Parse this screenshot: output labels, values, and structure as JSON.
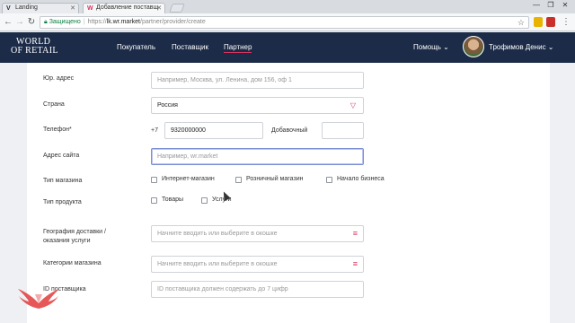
{
  "browser": {
    "tabs": [
      {
        "favicon": "V",
        "title": "Landing"
      },
      {
        "favicon": "W",
        "title": "Добавление поставщ"
      }
    ],
    "window_controls": [
      "—",
      "❐",
      "✕"
    ],
    "address": {
      "secure_label": "Защищено",
      "scheme": "https://",
      "host": "lk.wr.market",
      "path": "/partner/provider/create"
    }
  },
  "site": {
    "logo_line1": "WORLD",
    "logo_line2": "OF RETAIL",
    "nav": [
      "Покупатель",
      "Поставщик",
      "Партнер"
    ],
    "help": "Помощь",
    "user": "Трофимов Денис",
    "colors": {
      "header": "#1c2b48",
      "accent": "#d7345e"
    }
  },
  "form": {
    "legal_address": {
      "label": "Юр. адрес",
      "placeholder": "Например, Москва, ул. Ленина, дом 156, оф 1"
    },
    "country": {
      "label": "Страна",
      "value": "Россия"
    },
    "phone": {
      "label": "Телефон*",
      "prefix": "+7",
      "value": "9320000000",
      "ext_label": "Добавочный",
      "ext_value": ""
    },
    "website": {
      "label": "Адрес сайта",
      "placeholder": "Например, wr.market"
    },
    "store_type": {
      "label": "Тип магазина",
      "options": [
        "Интернет-магазин",
        "Розничный магазин",
        "Начало бизнеса"
      ]
    },
    "product_type": {
      "label": "Тип продукта",
      "options": [
        "Товары",
        "Услуги"
      ]
    },
    "geography": {
      "label_line1": "География доставки /",
      "label_line2": "оказания услуги",
      "placeholder": "Начните вводить или выберите в окошке"
    },
    "categories": {
      "label": "Категории магазина",
      "placeholder": "Начните вводить или выберите в окошке"
    },
    "supplier_id": {
      "label": "ID поставщика",
      "placeholder": "ID поставщика должен содержать до 7 цифр"
    }
  }
}
